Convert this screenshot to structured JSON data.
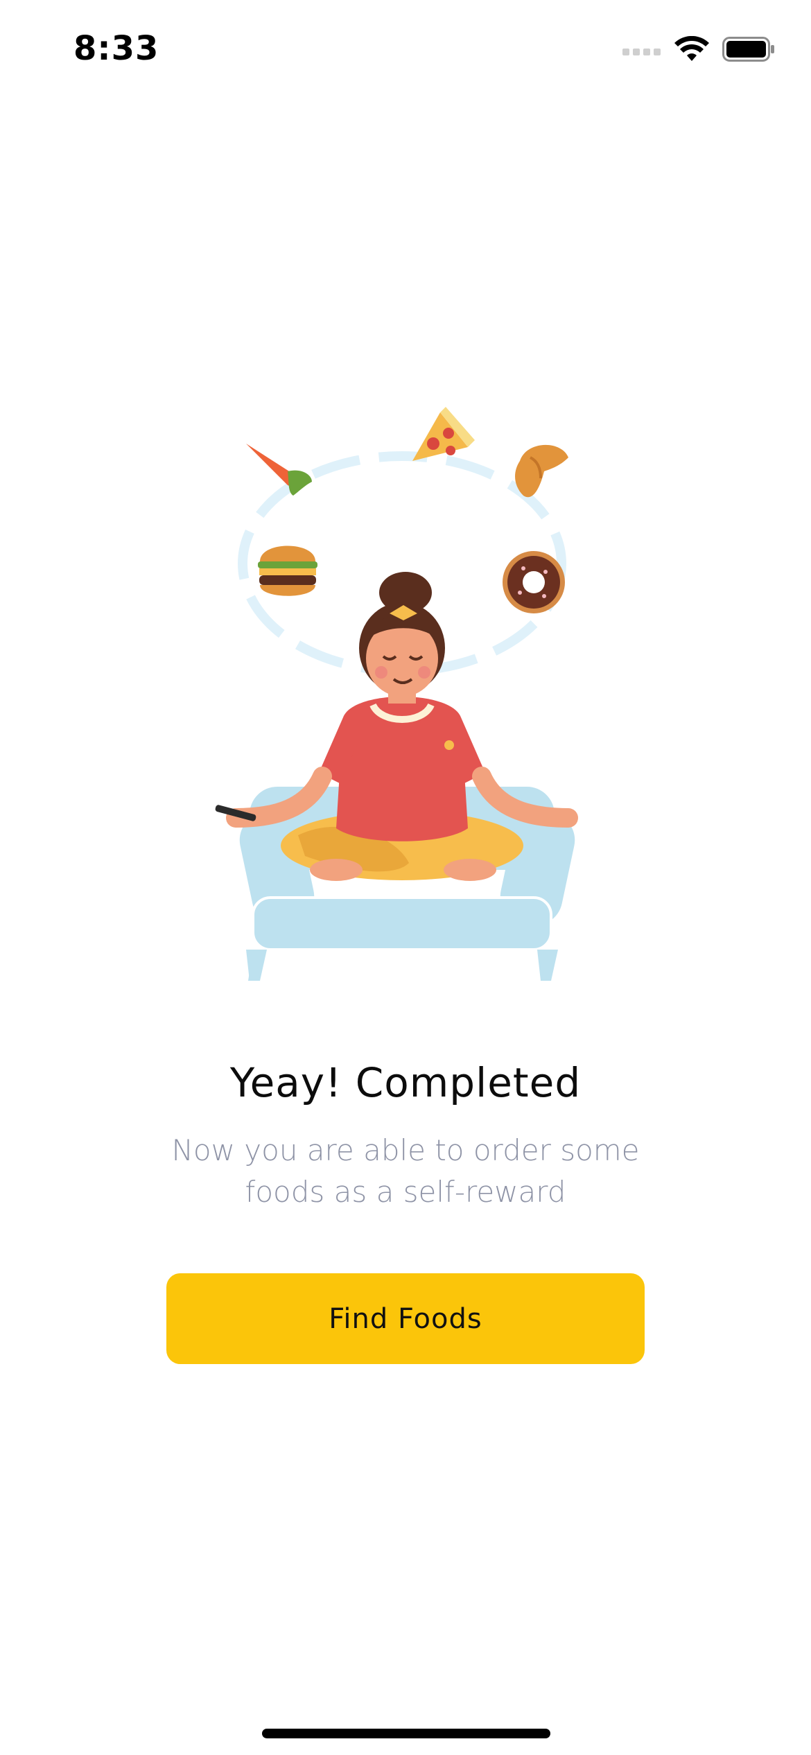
{
  "status_bar": {
    "time": "8:33"
  },
  "illustration": {
    "icons": [
      "pizza-icon",
      "carrot-icon",
      "croissant-icon",
      "burger-icon",
      "donut-icon"
    ],
    "colors": {
      "sofa": "#bde1ef",
      "shirt": "#e35450",
      "pants": "#f7bd4c",
      "skin": "#f2a27e",
      "hair": "#5a2e1e",
      "ring": "#dff1fa"
    }
  },
  "content": {
    "title": "Yeay! Completed",
    "subtitle": "Now you are able to order some foods as a self-reward"
  },
  "button": {
    "label": "Find Foods",
    "color": "#fbc50a"
  }
}
